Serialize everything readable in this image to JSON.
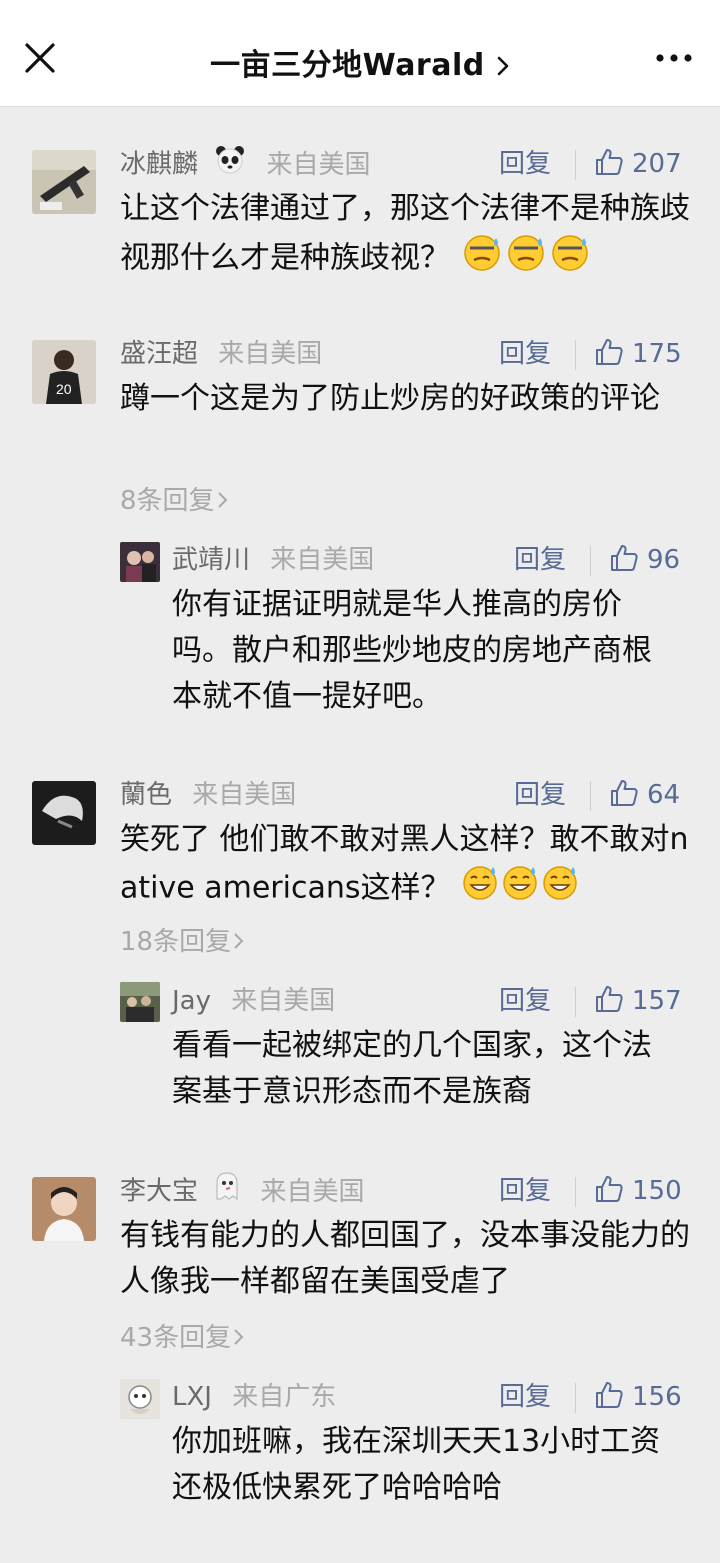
{
  "header": {
    "title": "一亩三分地Warald",
    "close_icon": "close-icon",
    "more_icon": "more-icon",
    "chevron_icon": "chevron-right-icon"
  },
  "labels": {
    "reply": "回复"
  },
  "comments": [
    {
      "nick": "冰麒麟",
      "nick_emoji": "panda-emoji",
      "location": "来自美国",
      "likes": "207",
      "text": "让这个法律通过了，那这个法律不是种族歧视那什么才是种族歧视？",
      "trailing_emoji": [
        "sweat-smile-face",
        "sweat-smile-face",
        "sweat-smile-face"
      ]
    },
    {
      "nick": "盛汪超",
      "location": "来自美国",
      "likes": "175",
      "text": "蹲一个这是为了防止炒房的好政策的评论",
      "more_replies": "8条回复",
      "reply": {
        "nick": "武靖川",
        "location": "来自美国",
        "likes": "96",
        "text": "你有证据证明就是华人推高的房价吗。散户和那些炒地皮的房地产商根本就不值一提好吧。"
      }
    },
    {
      "nick": "蘭色",
      "location": "来自美国",
      "likes": "64",
      "text": "笑死了 他们敢不敢对黑人这样？敢不敢对native americans这样？",
      "trailing_emoji": [
        "grin-sweat",
        "grin-sweat",
        "grin-sweat"
      ],
      "more_replies": "18条回复",
      "reply": {
        "nick": "Jay",
        "location": "来自美国",
        "likes": "157",
        "text": "看看一起被绑定的几个国家，这个法案基于意识形态而不是族裔"
      }
    },
    {
      "nick": "李大宝",
      "nick_emoji": "ghost-emoji",
      "location": "来自美国",
      "likes": "150",
      "text": "有钱有能力的人都回国了，没本事没能力的人像我一样都留在美国受虐了",
      "more_replies": "43条回复",
      "reply": {
        "nick": "LXJ",
        "location": "来自广东",
        "likes": "156",
        "text": "你加班嘛，我在深圳天天13小时工资还极低快累死了哈哈哈哈"
      }
    }
  ],
  "colors": {
    "link": "#576b95",
    "nick": "#6a6a6a",
    "muted": "#a9a9a9",
    "bg": "#ededed"
  }
}
